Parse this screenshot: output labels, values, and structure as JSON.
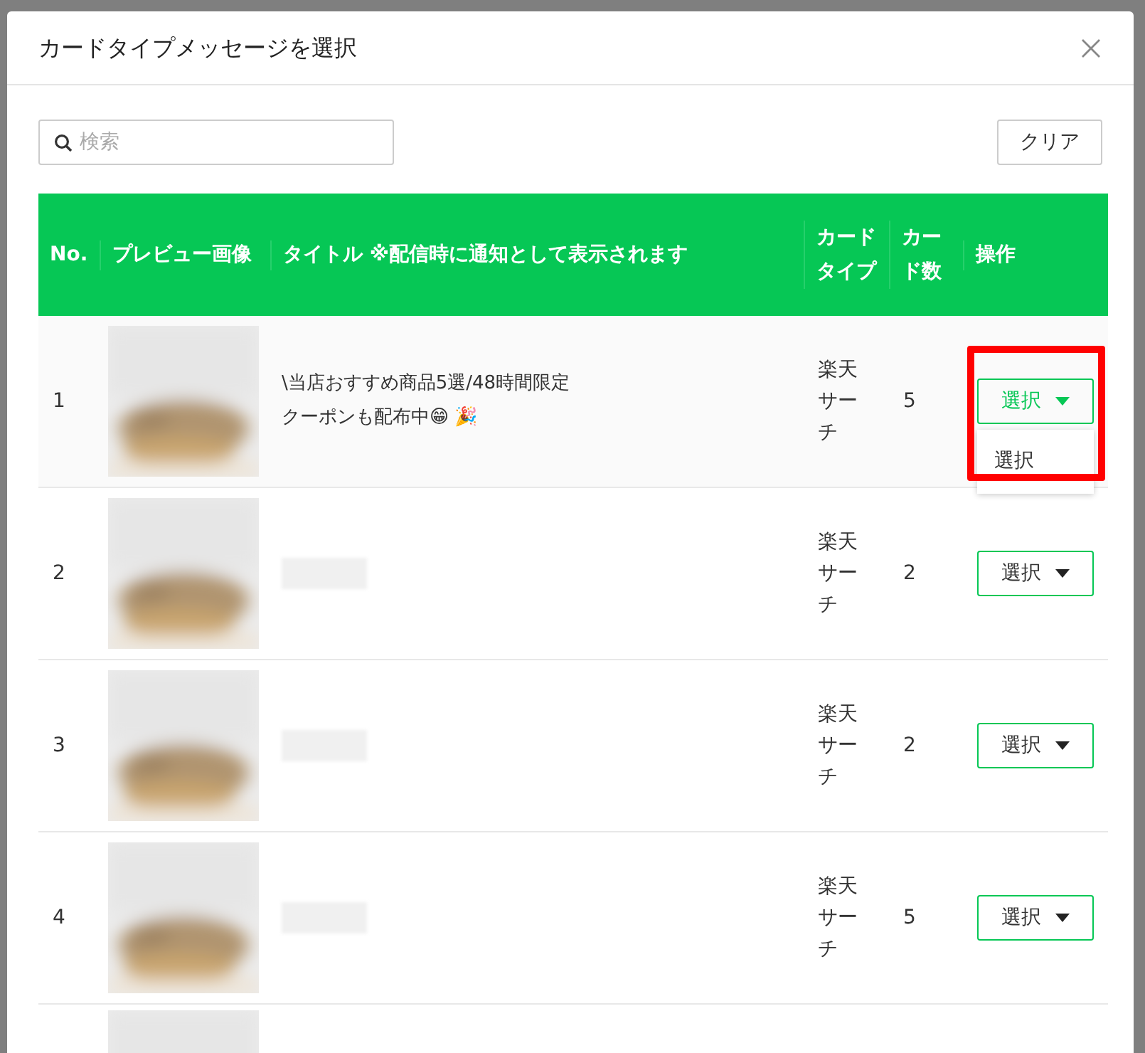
{
  "dialog": {
    "title": "カードタイプメッセージを選択"
  },
  "search": {
    "placeholder": "検索"
  },
  "clear_button": "クリア",
  "table": {
    "columns": [
      "No.",
      "プレビュー画像",
      "タイトル ※配信時に通知として表示されます",
      "カードタイプ",
      "カード数",
      "操作"
    ],
    "rows": [
      {
        "no": "1",
        "title": "\\当店おすすめ商品5選/48時間限定クーポンも配布中😁 🎉",
        "redacted": false,
        "card_type": "楽天サーチ",
        "count": "5",
        "action": "選択",
        "open": true,
        "highlighted": true,
        "menu": [
          "選択"
        ]
      },
      {
        "no": "2",
        "redacted": true,
        "card_type": "楽天サーチ",
        "count": "2",
        "action": "選択",
        "open": false,
        "highlighted": false
      },
      {
        "no": "3",
        "redacted": true,
        "card_type": "楽天サーチ",
        "count": "2",
        "action": "選択",
        "open": false,
        "highlighted": false
      },
      {
        "no": "4",
        "redacted": true,
        "card_type": "楽天サーチ",
        "count": "5",
        "action": "選択",
        "open": false,
        "highlighted": false
      }
    ]
  }
}
